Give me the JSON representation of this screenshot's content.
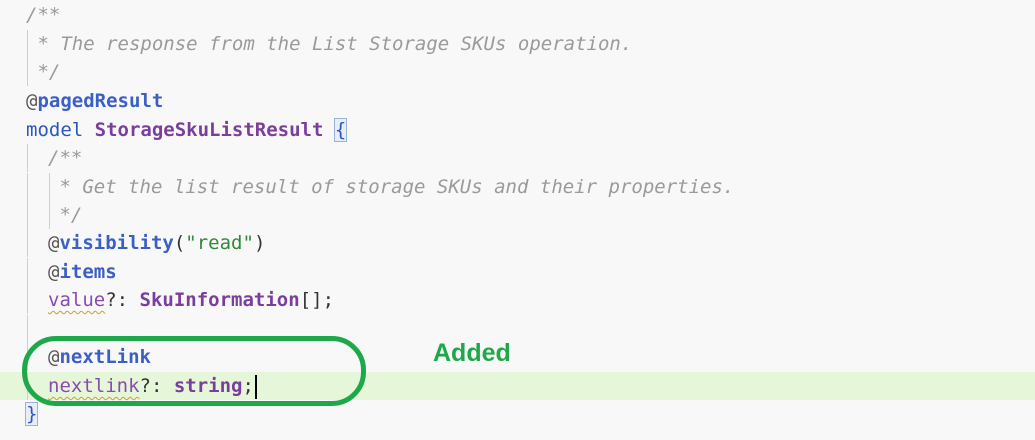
{
  "editor": {
    "lines": [
      {
        "text": "/**"
      },
      {
        "text": " * The response from the List Storage SKUs operation."
      },
      {
        "text": " */"
      },
      {
        "at": "@",
        "decorator": "pagedResult"
      },
      {
        "keyword": "model",
        "type_name": "StorageSkuListResult",
        "brace": "{"
      },
      {
        "text": "/**"
      },
      {
        "text": " * Get the list result of storage SKUs and their properties."
      },
      {
        "text": " */"
      },
      {
        "at": "@",
        "decorator": "visibility",
        "open": "(",
        "string": "\"read\"",
        "close": ")"
      },
      {
        "at": "@",
        "decorator": "items"
      },
      {
        "prop": "value",
        "opt": "?: ",
        "type_ref": "SkuInformation",
        "suffix": "[];"
      },
      {
        "at": "@",
        "decorator": "nextLink"
      },
      {
        "prop": "nextlink",
        "opt": "?: ",
        "type_ref": "string",
        "suffix": ";"
      },
      {
        "brace": "}"
      }
    ]
  },
  "annotation": {
    "label": "Added",
    "color": "#1fa84a"
  },
  "colors": {
    "background": "#f8f8f8",
    "added_line_bg": "#e6f6d8",
    "comment": "#9a9a9a",
    "decorator": "#3b5fc4",
    "type": "#7a3e9d",
    "string": "#2f8a3a"
  }
}
